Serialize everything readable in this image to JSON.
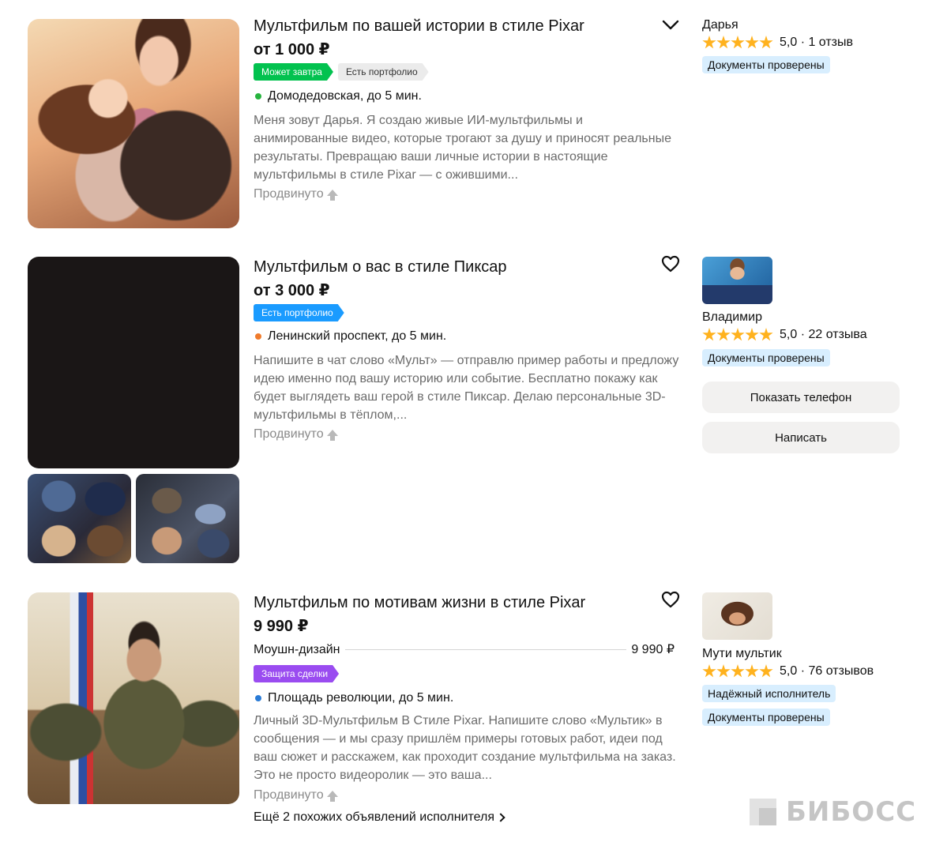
{
  "listings": [
    {
      "title": "Мультфильм по вашей истории в стиле Pixar",
      "price": "от 1 000 ₽",
      "badges": [
        "Может завтра",
        "Есть портфолио"
      ],
      "metro": "Домодедовская, до 5 мин.",
      "metro_color": "#27b43e",
      "description": "Меня зовут Дарья. Я создаю живые ИИ-мультфильмы и анимированные видео, которые трогают за душу и приносят реальные результаты. Превращаю ваши личные истории в настоящие мультфильмы в стиле Pixar — с ожившими...",
      "promoted": "Продвинуто",
      "favorite_icon": "chevron-down-icon",
      "seller": {
        "name": "Дарья",
        "rating": "5,0 · 1 отзыв",
        "tags": [
          "Документы проверены"
        ]
      }
    },
    {
      "title": "Мультфильм о вас в стиле Пиксар",
      "price": "от 3 000 ₽",
      "badges": [
        "Есть портфолио"
      ],
      "metro": "Ленинский проспект, до 5 мин.",
      "metro_color": "#f07b2c",
      "description": "Напишите в чат слово «Мульт» — отправлю пример работы и предложу идею именно под вашу историю или событие. Бесплатно покажу как будет выглядеть ваш герой в стиле Пиксар. Делаю персональные 3D-мультфильмы в тёплом,...",
      "promoted": "Продвинуто",
      "favorite_icon": "heart-icon",
      "seller": {
        "name": "Владимир",
        "rating": "5,0 · 22 отзыва",
        "tags": [
          "Документы проверены"
        ],
        "show_phone": "Показать телефон",
        "write": "Написать"
      }
    },
    {
      "title": "Мультфильм по мотивам жизни в стиле Pixar",
      "price": "9 990 ₽",
      "service": {
        "name": "Моушн-дизайн",
        "price": "9 990 ₽"
      },
      "badges": [
        "Защита сделки"
      ],
      "metro": "Площадь революции, до 5 мин.",
      "metro_color": "#2a7bd6",
      "description": "Личный 3D-Мультфильм В Стиле Pixar. Напишите слово «Мультик» в сообщения — и мы сразу пришлём примеры готовых работ, идеи под ваш сюжет и расскажем, как проходит создание мультфильма на заказ. Это не просто видеоролик — это ваша...",
      "promoted": "Продвинуто",
      "more_link": "Ещё 2 похожих объявлений исполнителя",
      "favorite_icon": "heart-icon",
      "seller": {
        "name": "Мути мультик",
        "rating": "5,0 · 76 отзывов",
        "tags": [
          "Надёжный исполнитель",
          "Документы проверены"
        ]
      }
    }
  ],
  "watermark": "БИБОСС"
}
